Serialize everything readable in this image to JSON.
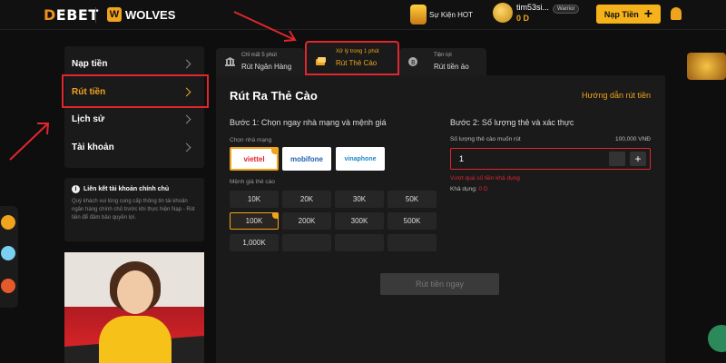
{
  "header": {
    "logo_main": "DEBET",
    "partner": "WOLVES",
    "event_label": "Sự Kiện HOT",
    "username": "tim53si...",
    "balance": "0 D",
    "rank": "Warrior",
    "deposit_label": "Nạp Tiền"
  },
  "sidebar": {
    "items": [
      {
        "label": "Nạp tiền"
      },
      {
        "label": "Rút tiền"
      },
      {
        "label": "Lịch sử"
      },
      {
        "label": "Tài khoản"
      }
    ],
    "link_bank_title": "Liên kết tài khoản chính chủ",
    "link_bank_desc": "Quý khách vui lòng cung cấp thông tin tài khoản ngân hàng chính chủ trước khi thực hiện Nạp - Rút tiền để đảm bảo quyền lợi."
  },
  "tabs": [
    {
      "small": "Chỉ mất 5 phút",
      "label": "Rút Ngân Hàng"
    },
    {
      "small": "Xử lý trong 1 phút",
      "label": "Rút Thẻ Cào"
    },
    {
      "small": "Tiện lợi",
      "label": "Rút tiền ảo"
    }
  ],
  "main": {
    "title": "Rút Ra Thẻ Cào",
    "guide_link": "Hướng dẫn rút tiền",
    "step1_title": "Bước 1: Chọn ngay nhà mạng và mệnh giá",
    "carrier_label": "Chọn nhà mạng",
    "carriers": [
      "viettel",
      "mobifone",
      "vinaphone"
    ],
    "denom_label": "Mệnh giá thẻ cào",
    "denoms": [
      "10K",
      "20K",
      "30K",
      "50K",
      "100K",
      "200K",
      "300K",
      "500K",
      "1,000K"
    ],
    "selected_denom": "100K",
    "step2_title": "Bước 2: Số lượng thẻ và xác thực",
    "qty_label": "Số lượng thẻ cào muốn rút",
    "qty_total": "100,000 VNĐ",
    "qty_value": "1",
    "error_text": "Vượt quá số tiền khả dụng",
    "avail_label": "Khả dụng:",
    "avail_amount": "0 D",
    "withdraw_button": "Rút tiền ngay"
  },
  "colors": {
    "accent": "#f0a31c",
    "highlight": "#e0262e",
    "panel": "#1a1a1a"
  }
}
